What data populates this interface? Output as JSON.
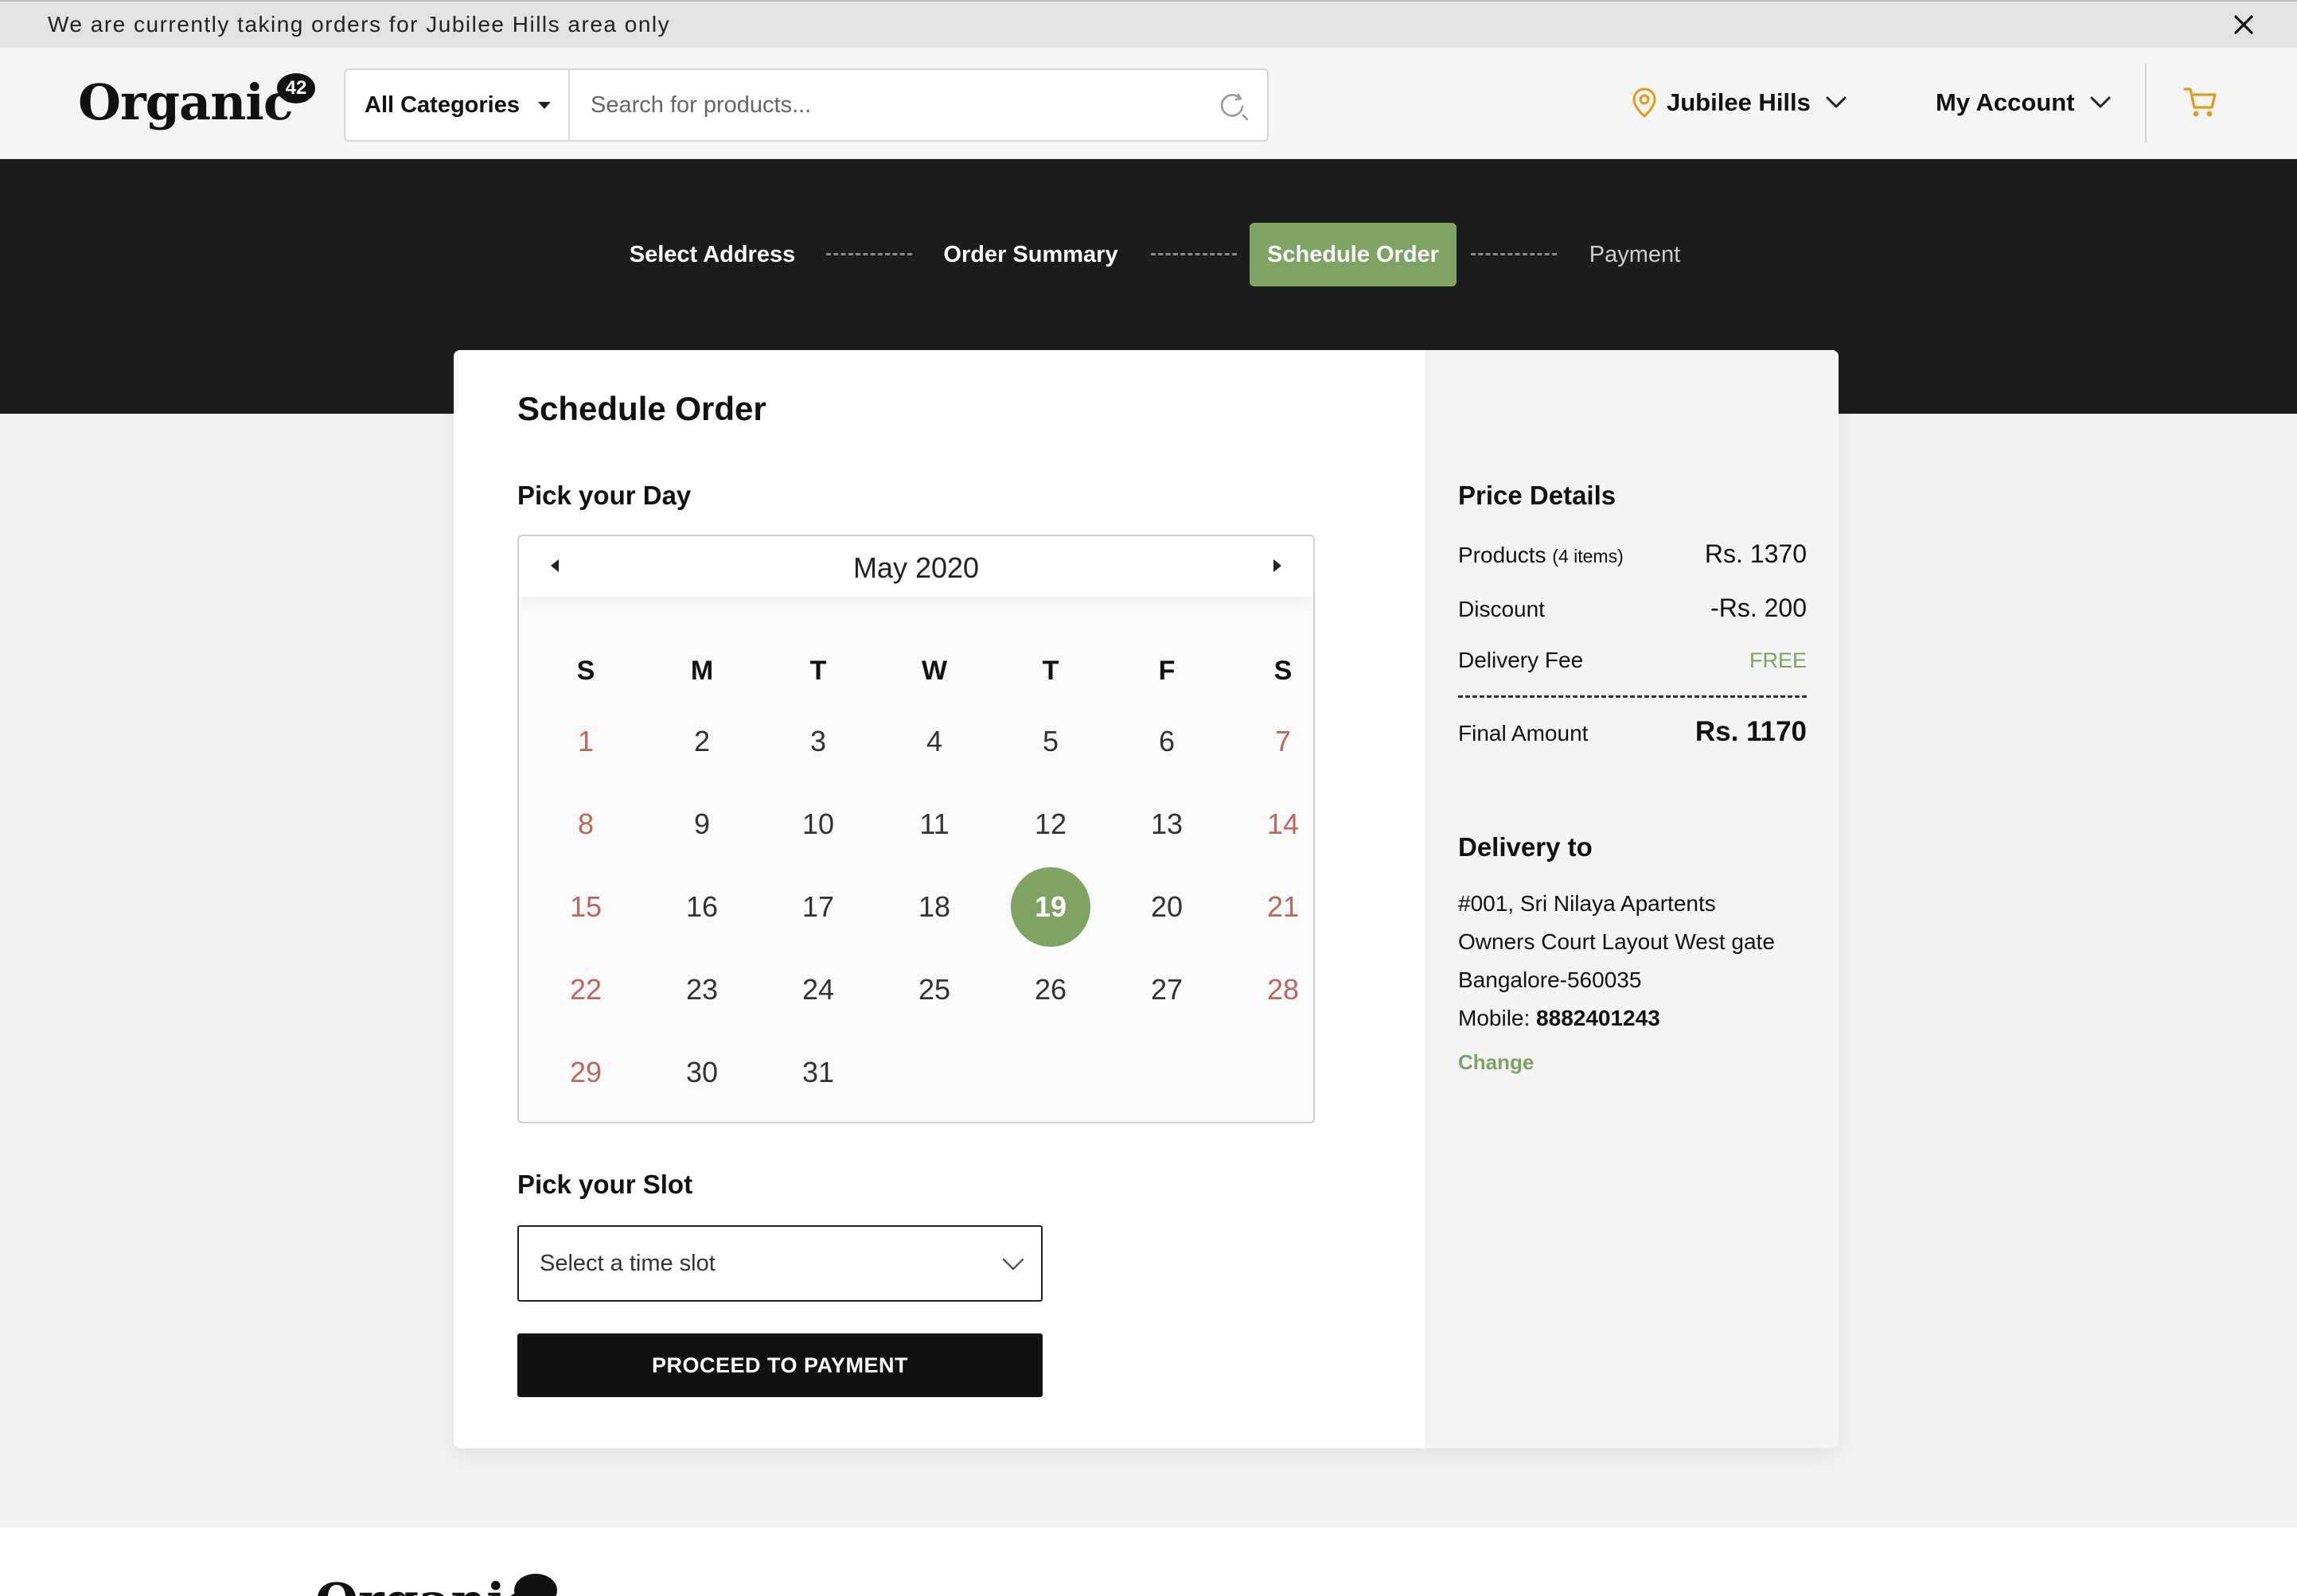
{
  "announcement": {
    "text": "We are currently taking orders for Jubilee Hills area only"
  },
  "header": {
    "logo_text": "Organic",
    "logo_badge": "42",
    "category_label": "All Categories",
    "search_placeholder": "Search for products...",
    "location_label": "Jubilee Hills",
    "account_label": "My Account"
  },
  "steps": [
    {
      "label": "Select Address",
      "state": "done"
    },
    {
      "label": "Order Summary",
      "state": "done"
    },
    {
      "label": "Schedule Order",
      "state": "active"
    },
    {
      "label": "Payment",
      "state": "pending"
    }
  ],
  "schedule": {
    "title": "Schedule Order",
    "pick_day_label": "Pick your Day",
    "pick_slot_label": "Pick your Slot",
    "slot_placeholder": "Select a time slot",
    "proceed_label": "PROCEED TO PAYMENT"
  },
  "calendar": {
    "month_label": "May 2020",
    "weekdays": [
      "S",
      "M",
      "T",
      "W",
      "T",
      "F",
      "S"
    ],
    "weeks": [
      [
        "1",
        "2",
        "3",
        "4",
        "5",
        "6",
        "7"
      ],
      [
        "8",
        "9",
        "10",
        "11",
        "12",
        "13",
        "14"
      ],
      [
        "15",
        "16",
        "17",
        "18",
        "19",
        "20",
        "21"
      ],
      [
        "22",
        "23",
        "24",
        "25",
        "26",
        "27",
        "28"
      ],
      [
        "29",
        "30",
        "31"
      ]
    ],
    "selected_day": "19"
  },
  "price_details": {
    "title": "Price Details",
    "products_label": "Products",
    "products_count": "(4 items)",
    "products_value": "Rs. 1370",
    "discount_label": "Discount",
    "discount_value": "-Rs. 200",
    "delivery_label": "Delivery Fee",
    "delivery_value": "FREE",
    "final_label": "Final Amount",
    "final_value": "Rs. 1170"
  },
  "delivery": {
    "title": "Delivery to",
    "line1": "#001, Sri Nilaya Apartents",
    "line2": "Owners Court Layout West gate",
    "line3": "Bangalore-560035",
    "mobile_label": "Mobile:",
    "mobile_value": "8882401243",
    "change_label": "Change"
  },
  "colors": {
    "accent_green": "#7ea463",
    "weekend_red": "#c0655b",
    "dark_band": "#1c1c1c",
    "cart_orange": "#e39b1c"
  },
  "icons": {
    "close": "close-icon",
    "search": "search-icon",
    "location": "location-pin-icon",
    "cart": "cart-icon",
    "chevron": "chevron-down-icon"
  }
}
